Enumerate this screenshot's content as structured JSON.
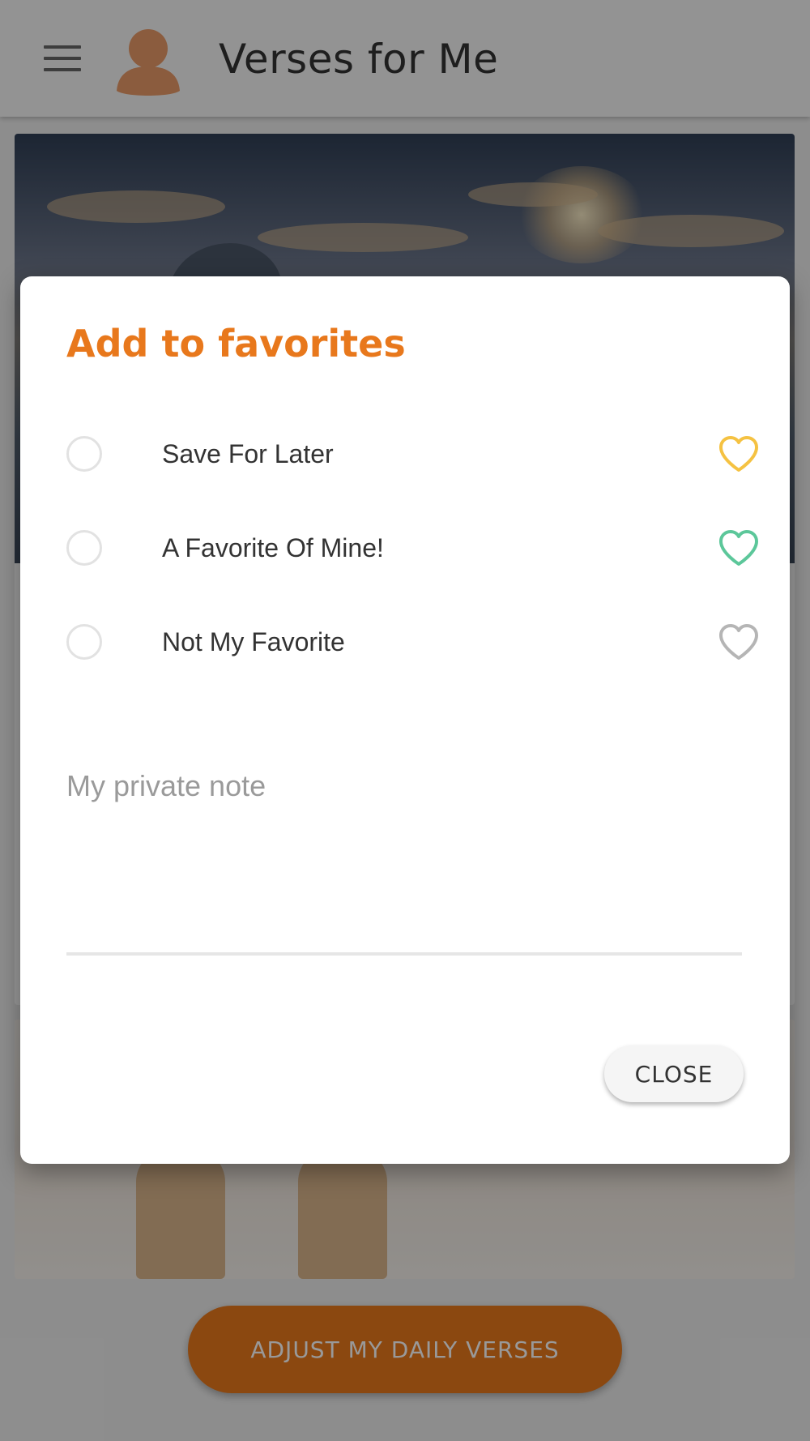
{
  "appbar": {
    "title": "Verses for Me",
    "menu_icon": "hamburger-menu-icon",
    "avatar_icon": "user-avatar-icon"
  },
  "fab": {
    "label": "ADJUST MY DAILY VERSES"
  },
  "dialog": {
    "title": "Add to favorites",
    "options": [
      {
        "label": "Save For Later",
        "heart_color": "#f5c242",
        "selected": false
      },
      {
        "label": "A Favorite Of Mine!",
        "heart_color": "#5cc79a",
        "selected": false
      },
      {
        "label": "Not My Favorite",
        "heart_color": "#b5b5b5",
        "selected": false
      }
    ],
    "note_placeholder": "My private note",
    "close_label": "CLOSE"
  },
  "colors": {
    "accent": "#e8781c",
    "scrim": "rgba(0,0,0,0.4)"
  }
}
